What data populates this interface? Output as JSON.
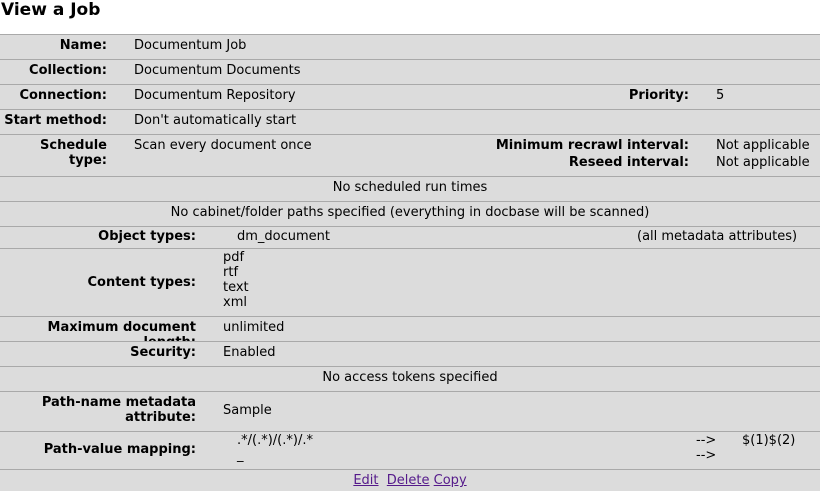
{
  "page": {
    "title": "View a Job"
  },
  "job": {
    "name_label": "Name:",
    "name": "Documentum Job",
    "collection_label": "Collection:",
    "collection": "Documentum Documents",
    "connection_label": "Connection:",
    "connection": "Documentum Repository",
    "priority_label": "Priority:",
    "priority": "5",
    "start_method_label": "Start method:",
    "start_method": "Don't automatically start",
    "schedule_type_label": "Schedule type:",
    "schedule_type": "Scan every document once",
    "min_recrawl_label": "Minimum recrawl interval:",
    "min_recrawl": "Not applicable",
    "reseed_label": "Reseed interval:",
    "reseed": "Not applicable",
    "schedule_note": "No scheduled run times",
    "paths_note": "No cabinet/folder paths specified (everything in docbase will be scanned)",
    "object_types_label": "Object types:",
    "object_types": "dm_document",
    "object_types_attrs": "(all metadata attributes)",
    "content_types_label": "Content types:",
    "content_types": [
      "pdf",
      "rtf",
      "text",
      "xml"
    ],
    "max_length_label": "Maximum document length:",
    "max_length": "unlimited",
    "security_label": "Security:",
    "security": "Enabled",
    "tokens_note": "No access tokens specified",
    "path_attr_label_1": "Path-name metadata",
    "path_attr_label_2": "attribute:",
    "path_attr": "Sample",
    "path_mapping_label": "Path-value mapping:",
    "mapping": [
      {
        "match": ".*/(.*)/(.*)/.*",
        "arrow": "-->",
        "replace": "$(1)$(2)"
      },
      {
        "match": "_",
        "arrow": "-->",
        "replace": ""
      }
    ]
  },
  "actions": {
    "edit": "Edit",
    "delete": "Delete",
    "copy": "Copy"
  }
}
